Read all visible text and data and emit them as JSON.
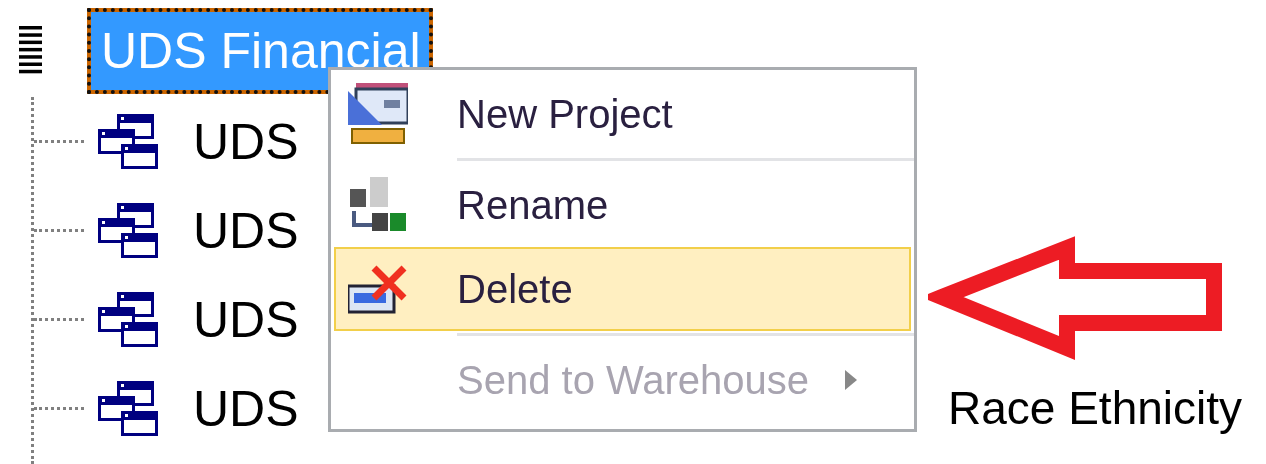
{
  "tree": {
    "root": {
      "label": "UDS Financial",
      "selected": true,
      "children": [
        {
          "label": "UDS",
          "selected": false
        },
        {
          "label": "UDS",
          "selected": false
        },
        {
          "label": "UDS",
          "selected": false
        },
        {
          "label": "UDS",
          "tail": "Race Ethnicity",
          "selected": false
        }
      ]
    }
  },
  "context_menu": {
    "items": [
      {
        "label": "New Project",
        "kind": "command",
        "selected": false,
        "disabled": false,
        "separator_after": true
      },
      {
        "label": "Rename",
        "kind": "command",
        "selected": false,
        "disabled": false,
        "separator_after": false
      },
      {
        "label": "Delete",
        "kind": "command",
        "selected": true,
        "disabled": false,
        "separator_after": true
      },
      {
        "label": "Send to Warehouse",
        "kind": "submenu",
        "selected": false,
        "disabled": true,
        "separator_after": false
      }
    ]
  },
  "annotation": {
    "kind": "arrow"
  }
}
